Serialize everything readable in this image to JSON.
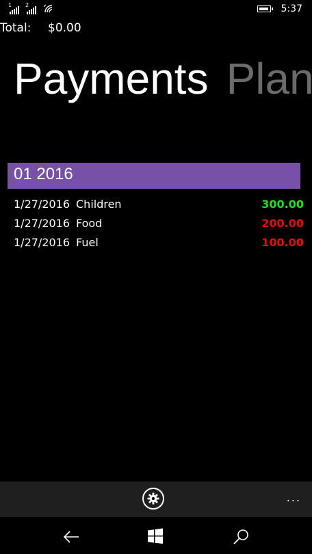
{
  "status": {
    "sim1": "1",
    "sim2": "2",
    "time": "5:37"
  },
  "total": {
    "label": "Total:",
    "value": "$0.00"
  },
  "pivot": {
    "tabs": [
      "Payments",
      "Plans"
    ]
  },
  "group": {
    "header": "01 2016"
  },
  "payments": [
    {
      "date": "1/27/2016",
      "category": "Children",
      "amount": "300.00",
      "color": "#22dd22"
    },
    {
      "date": "1/27/2016",
      "category": "Food",
      "amount": "200.00",
      "color": "#e60d0d"
    },
    {
      "date": "1/27/2016",
      "category": "Fuel",
      "amount": "100.00",
      "color": "#e60d0d"
    }
  ],
  "app_bar": {
    "more": "...",
    "settings_icon": "gear-icon"
  },
  "nav": {
    "icons": [
      "back-icon",
      "windows-icon",
      "search-icon"
    ]
  }
}
